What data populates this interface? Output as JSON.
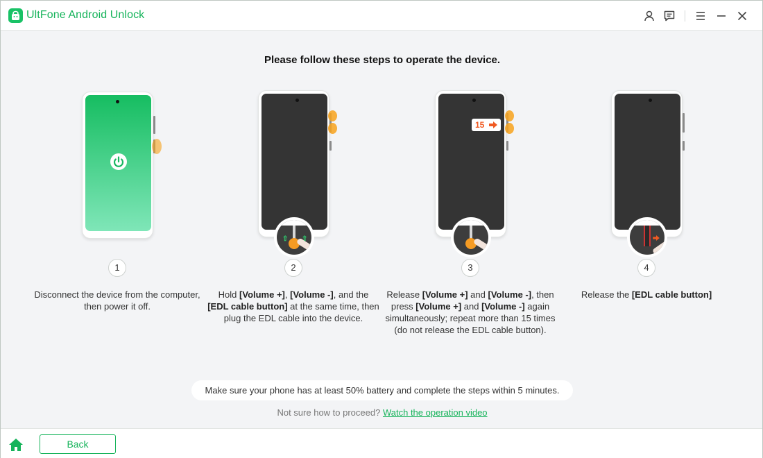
{
  "app": {
    "title": "UltFone Android Unlock",
    "accent_color": "#15b35a"
  },
  "titlebar": {
    "icons": [
      "user-icon",
      "feedback-icon",
      "menu-icon",
      "minimize-icon",
      "close-icon"
    ]
  },
  "main": {
    "heading": "Please follow these steps to operate the device.",
    "steps": [
      {
        "number": "1",
        "text": [
          {
            "t": "Disconnect the device from the computer, then power it off.",
            "b": false
          }
        ]
      },
      {
        "number": "2",
        "badge": "",
        "text": [
          {
            "t": "Hold ",
            "b": false
          },
          {
            "t": "[Volume +]",
            "b": true
          },
          {
            "t": ", ",
            "b": false
          },
          {
            "t": "[Volume -]",
            "b": true
          },
          {
            "t": ", and the ",
            "b": false
          },
          {
            "t": "[EDL cable button]",
            "b": true
          },
          {
            "t": " at the same time, then plug the EDL cable into the device.",
            "b": false
          }
        ]
      },
      {
        "number": "3",
        "badge": "15",
        "text": [
          {
            "t": "Release ",
            "b": false
          },
          {
            "t": "[Volume +]",
            "b": true
          },
          {
            "t": " and ",
            "b": false
          },
          {
            "t": "[Volume -]",
            "b": true
          },
          {
            "t": ", then press ",
            "b": false
          },
          {
            "t": "[Volume +]",
            "b": true
          },
          {
            "t": " and ",
            "b": false
          },
          {
            "t": "[Volume -]",
            "b": true
          },
          {
            "t": " again simultaneously; repeat more than 15 times (do not release the EDL cable button).",
            "b": false
          }
        ]
      },
      {
        "number": "4",
        "text": [
          {
            "t": "Release the ",
            "b": false
          },
          {
            "t": "[EDL cable button]",
            "b": true
          }
        ]
      }
    ],
    "note": "Make sure your phone has at least 50% battery and complete the steps within 5 minutes.",
    "help_prefix": "Not sure how to proceed?",
    "help_link": "Watch the operation video"
  },
  "footer": {
    "back_label": "Back"
  }
}
